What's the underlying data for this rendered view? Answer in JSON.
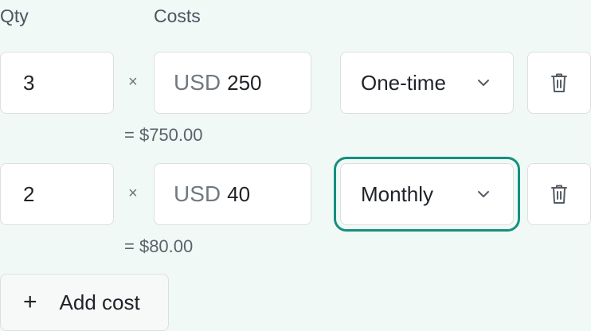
{
  "headers": {
    "qty": "Qty",
    "costs": "Costs"
  },
  "rows": [
    {
      "qty": "3",
      "times": "×",
      "currency": "USD",
      "amount": "250",
      "frequency": "One-time",
      "subtotal": "= $750.00"
    },
    {
      "qty": "2",
      "times": "×",
      "currency": "USD",
      "amount": "40",
      "frequency": "Monthly",
      "subtotal": "= $80.00"
    }
  ],
  "add_button": {
    "plus": "+",
    "label": "Add cost"
  },
  "colors": {
    "focus_ring": "#14907e",
    "background": "#f1f9f6"
  },
  "icons": {
    "dropdown": "chevron-down-icon",
    "delete": "trash-icon",
    "add": "plus-icon"
  }
}
